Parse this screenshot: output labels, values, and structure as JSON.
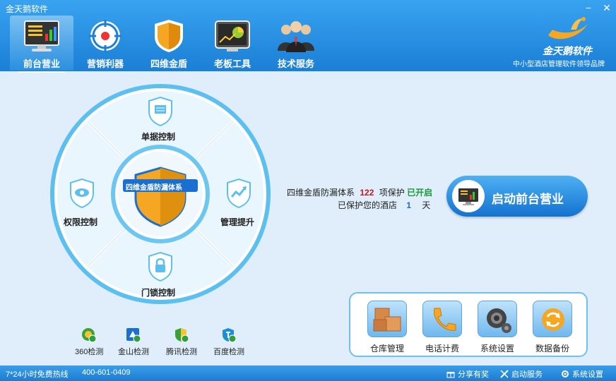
{
  "window": {
    "title": "金天鹅软件",
    "minimize": "−",
    "close": "✕"
  },
  "nav": [
    {
      "label": "前台营业",
      "icon": "monitor-chart-icon",
      "active": true
    },
    {
      "label": "营销利器",
      "icon": "target-icon",
      "active": false
    },
    {
      "label": "四维金盾",
      "icon": "shield-icon",
      "active": false
    },
    {
      "label": "老板工具",
      "icon": "dashboard-chart-icon",
      "active": false
    },
    {
      "label": "技术服务",
      "icon": "staff-group-icon",
      "active": false
    }
  ],
  "brand": {
    "name": "金天鹅软件",
    "slogan": "中小型酒店管理软件领导品牌"
  },
  "wheel": {
    "center_label": "四维金盾防漏体系",
    "modules": {
      "top": "单据控制",
      "left": "权限控制",
      "right": "管理提升",
      "bottom": "门锁控制"
    }
  },
  "status": {
    "line1_prefix": "四维金盾防漏体系",
    "count": "122",
    "line1_mid": "项保护",
    "enabled": "已开启",
    "line2_prefix": "已保护您的酒店",
    "days": "1",
    "line2_suffix": "天"
  },
  "launch_button": {
    "label": "启动前台营业"
  },
  "tools": [
    {
      "label": "仓库管理",
      "icon": "boxes-icon"
    },
    {
      "label": "电话计费",
      "icon": "phone-icon"
    },
    {
      "label": "系统设置",
      "icon": "gears-icon"
    },
    {
      "label": "数据备份",
      "icon": "refresh-icon"
    }
  ],
  "checks": [
    {
      "label": "360检测",
      "icon": "360-icon"
    },
    {
      "label": "金山检测",
      "icon": "kingsoft-icon"
    },
    {
      "label": "腾讯检测",
      "icon": "tencent-icon"
    },
    {
      "label": "百度检测",
      "icon": "baidu-icon"
    }
  ],
  "footer": {
    "hotline": "7*24小时免费热线",
    "phone": "400-601-0409",
    "links": [
      "分享有奖",
      "启动服务",
      "系统设置"
    ]
  },
  "colors": {
    "header": "#1b7fd6",
    "accent": "#39a3f0",
    "count": "#c8161d",
    "enabled": "#1a9b3a",
    "days": "#1b6fd0"
  }
}
